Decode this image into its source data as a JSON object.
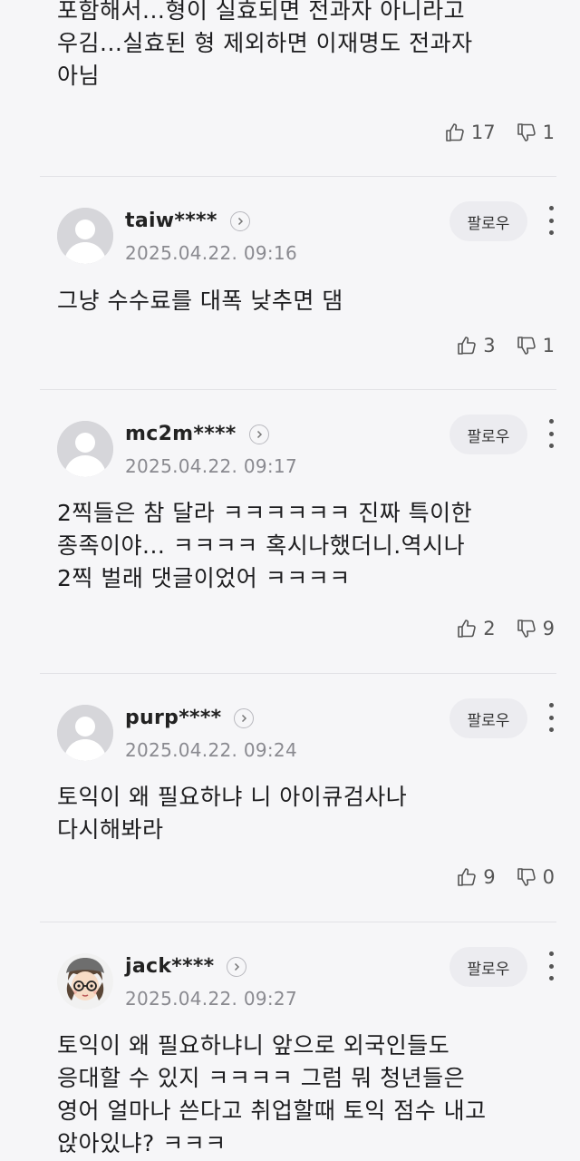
{
  "follow_label": "팔로우",
  "top_comment": {
    "text": "포함해서...형이 실효되면 전과자 아니라고\n우김...실효된 형 제외하면 이재명도 전과자\n아님",
    "likes": "17",
    "dislikes": "1"
  },
  "comments": [
    {
      "username": "taiw****",
      "timestamp": "2025.04.22. 09:16",
      "text": "그냥 수수료를 대폭 낮추면 댐",
      "likes": "3",
      "dislikes": "1",
      "avatar": "default-avatar-icon"
    },
    {
      "username": "mc2m****",
      "timestamp": "2025.04.22. 09:17",
      "text": "2찍들은 참 달라 ㅋㅋㅋㅋㅋㅋ 진짜 특이한\n종족이야... ㅋㅋㅋㅋ 혹시나했더니.역시나\n2찍 벌래 댓글이었어 ㅋㅋㅋㅋ",
      "likes": "2",
      "dislikes": "9",
      "avatar": "default-avatar-icon"
    },
    {
      "username": "purp****",
      "timestamp": "2025.04.22. 09:24",
      "text": "토익이 왜 필요하냐 니 아이큐검사나\n다시해봐라",
      "likes": "9",
      "dislikes": "0",
      "avatar": "default-avatar-icon"
    },
    {
      "username": "jack****",
      "timestamp": "2025.04.22. 09:27",
      "text": "토익이 왜 필요하냐니 앞으로 외국인들도\n응대할 수 있지 ㅋㅋㅋㅋ 그럼 뭐 청년들은\n영어 얼마나 쓴다고 취업할때 토익 점수 내고\n앉아있냐? ㅋㅋㅋ",
      "avatar": "cartoon-avatar-icon"
    }
  ]
}
